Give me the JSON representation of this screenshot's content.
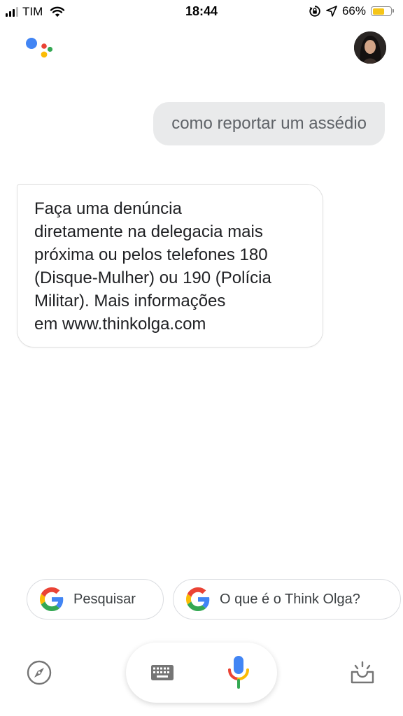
{
  "status_bar": {
    "carrier": "TIM",
    "time": "18:44",
    "battery_percent": "66%",
    "battery_level": 0.66,
    "icons": [
      "signal-icon",
      "wifi-icon",
      "orientation-lock-icon",
      "location-arrow-icon",
      "battery-icon"
    ]
  },
  "header": {
    "logo": "google-assistant-logo",
    "avatar": "user-avatar"
  },
  "conversation": {
    "user_query": "como reportar um assédio",
    "assistant_reply_lines": [
      "Faça uma denúncia",
      "diretamente na delegacia mais",
      "próxima ou pelos telefones 180",
      "(Disque-Mulher) ou 190 (Polícia",
      "Militar). Mais informações",
      "em www.thinkolga.com"
    ]
  },
  "suggestions": [
    {
      "label": "Pesquisar",
      "icon": "google-g-icon"
    },
    {
      "label": "O que é o Think Olga?",
      "icon": "google-g-icon"
    }
  ],
  "bottom_bar": {
    "icons": [
      "explore-compass-icon",
      "keyboard-icon",
      "microphone-icon",
      "updates-inbox-icon"
    ]
  },
  "colors": {
    "google_blue": "#4285F4",
    "google_red": "#EA4335",
    "google_yellow": "#FBBC05",
    "google_green": "#34A853",
    "user_bubble_bg": "#e9eaeb",
    "battery_fill": "#f5c518"
  }
}
